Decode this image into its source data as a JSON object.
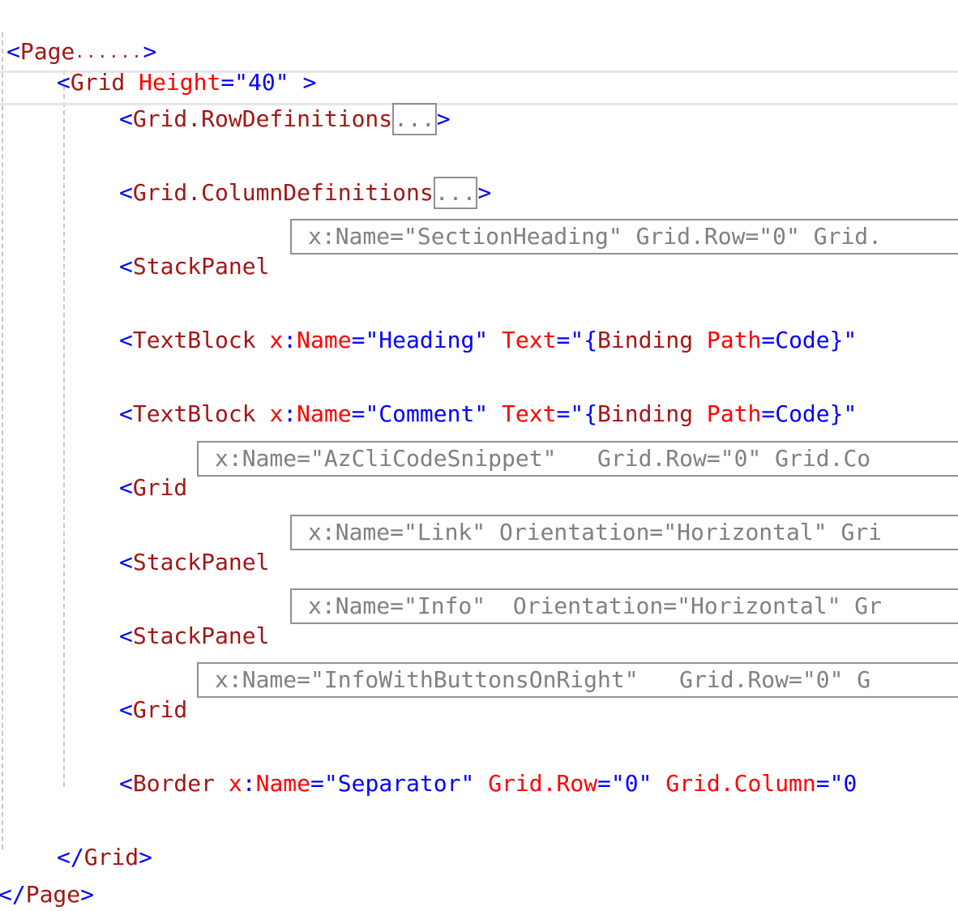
{
  "page_open": {
    "lt": "<",
    "tag": "Page",
    "ellipsis": "......",
    "gt": ">"
  },
  "grid_open": {
    "lt": "<",
    "tag": "Grid",
    "attr": "Height",
    "eq": "=",
    "value": "\"40\"",
    "gt": ">"
  },
  "row_defs": {
    "lt": "<",
    "tag": "Grid.RowDefinitions",
    "fold": "...",
    "gt": ">"
  },
  "col_defs": {
    "lt": "<",
    "tag": "Grid.ColumnDefinitions",
    "fold": "...",
    "gt": ">"
  },
  "children": [
    {
      "lt": "<",
      "tag": "StackPanel",
      "collapsed_attrs": "x:Name=\"SectionHeading\" Grid.Row=\"0\" Grid."
    },
    {
      "lt": "<",
      "tag": "TextBlock",
      "prefix": "x",
      "colon": ":",
      "attr1": "Name",
      "eq1": "=",
      "val1": "\"Heading\"",
      "attr2": "Text",
      "eq2": "=",
      "q": "\"",
      "brace_open": "{",
      "binding": "Binding",
      "path": "Path",
      "eq3": "=",
      "code": "Code",
      "brace_close": "}\""
    },
    {
      "lt": "<",
      "tag": "TextBlock",
      "prefix": "x",
      "colon": ":",
      "attr1": "Name",
      "eq1": "=",
      "val1": "\"Comment\"",
      "attr2": "Text",
      "eq2": "=",
      "q": "\"",
      "brace_open": "{",
      "binding": "Binding",
      "path": "Path",
      "eq3": "=",
      "code": "Code",
      "brace_close": "}\""
    },
    {
      "lt": "<",
      "tag": "Grid",
      "collapsed_attrs": "x:Name=\"AzCliCodeSnippet\"   Grid.Row=\"0\" Grid.Co"
    },
    {
      "lt": "<",
      "tag": "StackPanel",
      "collapsed_attrs": "x:Name=\"Link\" Orientation=\"Horizontal\" Gri"
    },
    {
      "lt": "<",
      "tag": "StackPanel",
      "collapsed_attrs": "x:Name=\"Info\"  Orientation=\"Horizontal\" Gr"
    },
    {
      "lt": "<",
      "tag": "Grid",
      "collapsed_attrs": "x:Name=\"InfoWithButtonsOnRight\"   Grid.Row=\"0\" G"
    },
    {
      "lt": "<",
      "tag": "Border",
      "prefix": "x",
      "colon": ":",
      "attr1": "Name",
      "eq1": "=",
      "val1": "\"Separator\"",
      "attr2": "Grid.Row",
      "eq2": "=",
      "val2": "\"0\"",
      "attr3": "Grid.Column",
      "eq3": "=",
      "val3": "\"0"
    }
  ],
  "grid_close": {
    "lt": "</",
    "tag": "Grid",
    "gt": ">"
  },
  "page_close": {
    "lt": "</",
    "tag": "Page",
    "gt": ">"
  },
  "colors": {
    "bracket": "#0000ff",
    "tag": "#a31515",
    "attribute": "#ff0000",
    "value": "#0000ff",
    "collapsed": "#808080"
  }
}
